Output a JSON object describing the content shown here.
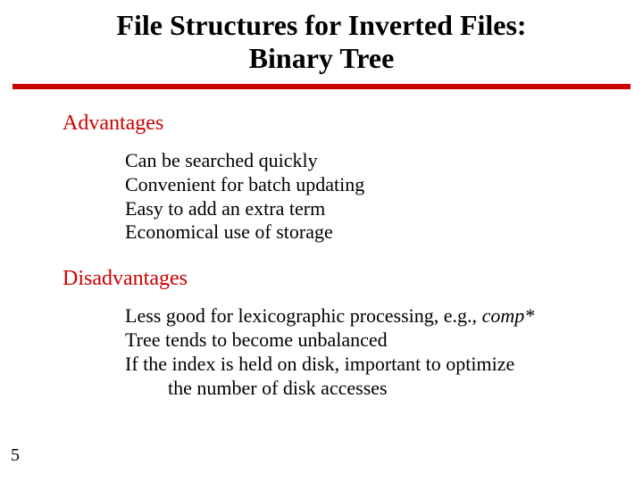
{
  "title_line1": "File Structures for Inverted Files:",
  "title_line2": "Binary Tree",
  "sections": {
    "advantages": {
      "heading": "Advantages",
      "items": [
        "Can be searched quickly",
        "Convenient for batch updating",
        "Easy to add an extra term",
        "Economical use of storage"
      ]
    },
    "disadvantages": {
      "heading": "Disadvantages",
      "item0_prefix": "Less good for lexicographic processing, e.g., ",
      "item0_emph": "comp*",
      "item1": "Tree tends to become unbalanced",
      "item2": "If the index is held on disk, important to optimize",
      "item2_cont": "the number of disk accesses"
    }
  },
  "page_number": "5"
}
